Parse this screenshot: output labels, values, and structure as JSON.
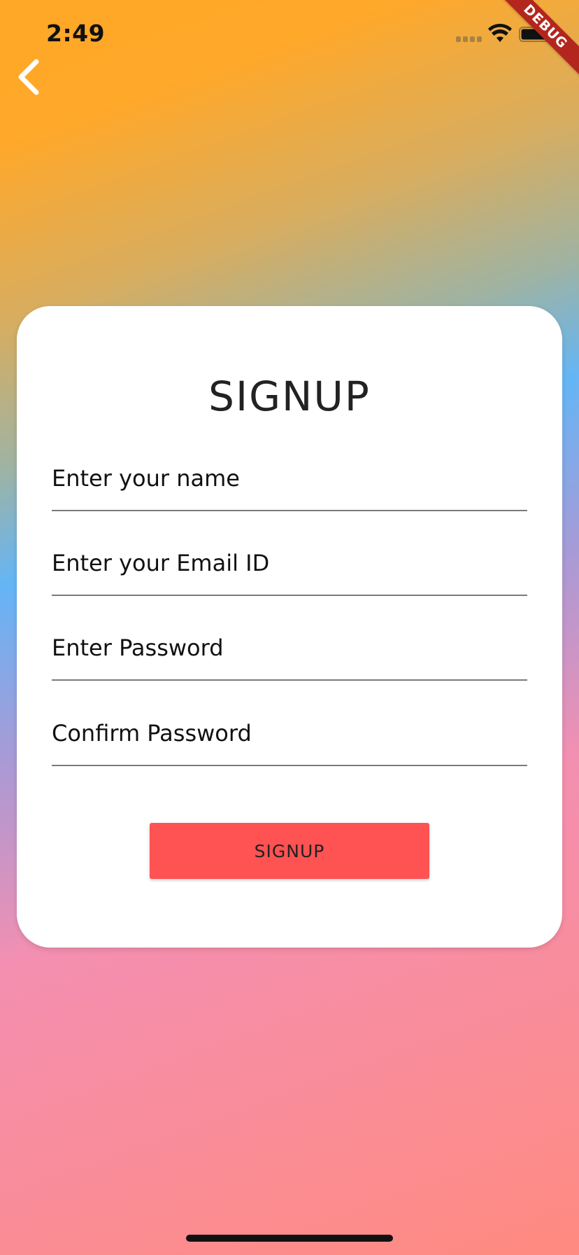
{
  "status_bar": {
    "time": "2:49",
    "icons": [
      "signal-icon",
      "wifi-icon",
      "battery-icon"
    ]
  },
  "debug_banner": {
    "label": "DEBUG",
    "color": "#b3261e"
  },
  "nav": {
    "back_icon": "chevron-left-icon"
  },
  "form": {
    "title": "SIGNUP",
    "fields": [
      {
        "name": "name",
        "placeholder": "Enter your name",
        "value": ""
      },
      {
        "name": "email",
        "placeholder": "Enter your Email ID",
        "value": ""
      },
      {
        "name": "password",
        "placeholder": "Enter Password",
        "value": ""
      },
      {
        "name": "confirm_password",
        "placeholder": "Confirm Password",
        "value": ""
      }
    ],
    "submit_label": "SIGNUP"
  },
  "colors": {
    "gradient_top": "#ffa726",
    "gradient_middle": "#64b5f6",
    "gradient_bottom": "#ff8a80",
    "button": "#ff5252",
    "card": "#ffffff"
  }
}
